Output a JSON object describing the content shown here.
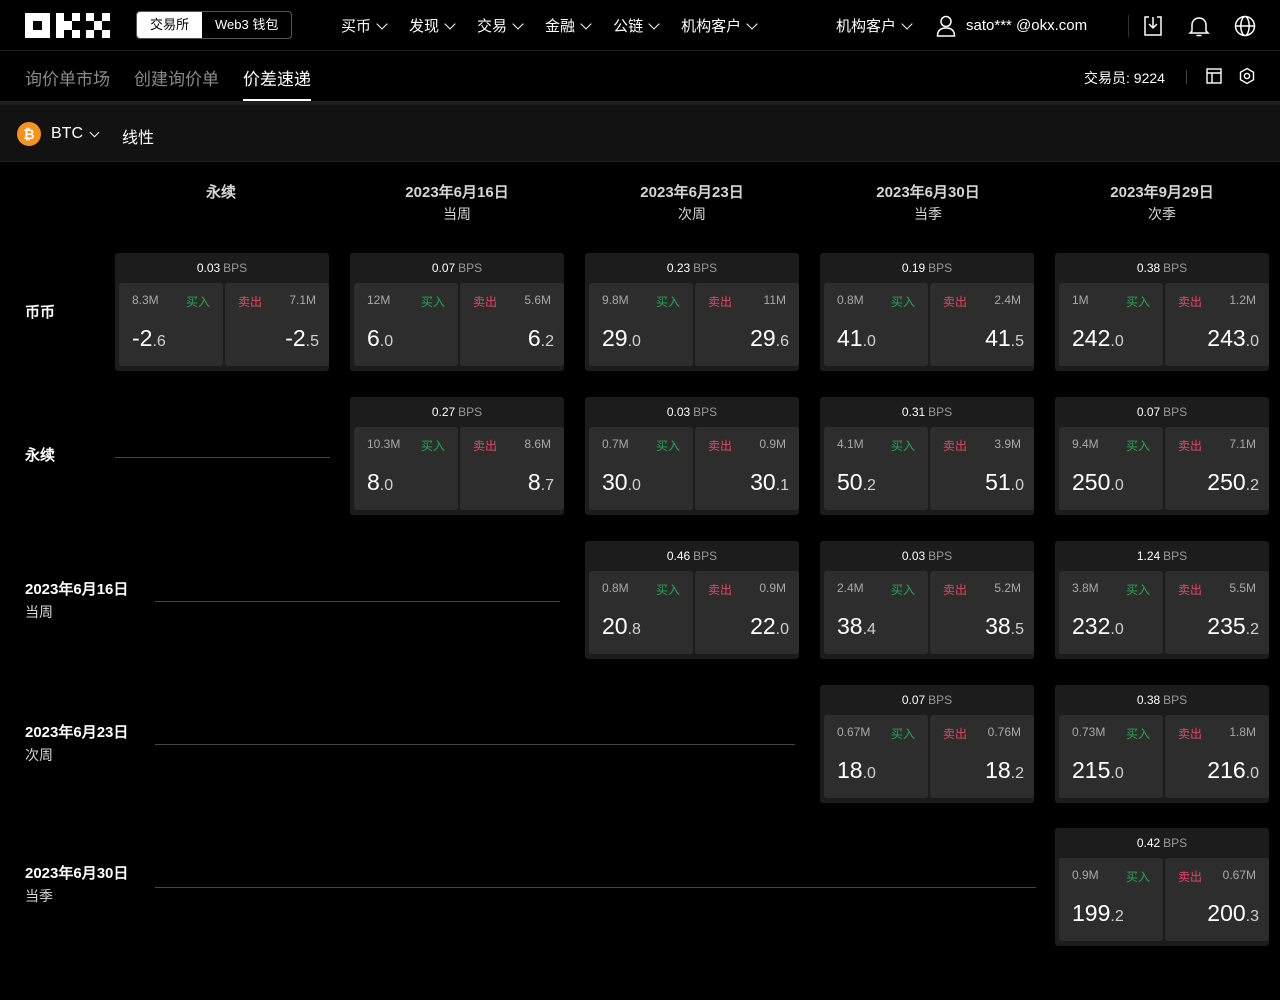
{
  "nav": {
    "switch": [
      "交易所",
      "Web3 钱包"
    ],
    "menu": [
      "买币",
      "发现",
      "交易",
      "金融",
      "公链",
      "机构客户"
    ],
    "institutional": "机构客户",
    "user": "sato*** @okx.com"
  },
  "subtabs": {
    "tabs": [
      "询价单市场",
      "创建询价单",
      "价差速递"
    ],
    "trader": "交易员: 9224"
  },
  "filter": {
    "coin": "BTC",
    "mode": "线性"
  },
  "columns": [
    {
      "date": "永续",
      "sub": ""
    },
    {
      "date": "2023年6月16日",
      "sub": "当周"
    },
    {
      "date": "2023年6月23日",
      "sub": "次周"
    },
    {
      "date": "2023年6月30日",
      "sub": "当季"
    },
    {
      "date": "2023年9月29日",
      "sub": "次季"
    }
  ],
  "rows": [
    {
      "date": "币币",
      "sub": ""
    },
    {
      "date": "永续",
      "sub": ""
    },
    {
      "date": "2023年6月16日",
      "sub": "当周"
    },
    {
      "date": "2023年6月23日",
      "sub": "次周"
    },
    {
      "date": "2023年6月30日",
      "sub": "当季"
    }
  ],
  "labels": {
    "buy": "买入",
    "sell": "卖出",
    "bps_unit": "BPS"
  },
  "cards": [
    {
      "row": 0,
      "col": 0,
      "bps": "0.03",
      "buy_vol": "8.3M",
      "buy_int": "-2",
      "buy_dec": ".6",
      "sell_vol": "7.1M",
      "sell_int": "-2",
      "sell_dec": ".5"
    },
    {
      "row": 0,
      "col": 1,
      "bps": "0.07",
      "buy_vol": "12M",
      "buy_int": "6",
      "buy_dec": ".0",
      "sell_vol": "5.6M",
      "sell_int": "6",
      "sell_dec": ".2"
    },
    {
      "row": 0,
      "col": 2,
      "bps": "0.23",
      "buy_vol": "9.8M",
      "buy_int": "29",
      "buy_dec": ".0",
      "sell_vol": "11M",
      "sell_int": "29",
      "sell_dec": ".6"
    },
    {
      "row": 0,
      "col": 3,
      "bps": "0.19",
      "buy_vol": "0.8M",
      "buy_int": "41",
      "buy_dec": ".0",
      "sell_vol": "2.4M",
      "sell_int": "41",
      "sell_dec": ".5"
    },
    {
      "row": 0,
      "col": 4,
      "bps": "0.38",
      "buy_vol": "1M",
      "buy_int": "242",
      "buy_dec": ".0",
      "sell_vol": "1.2M",
      "sell_int": "243",
      "sell_dec": ".0"
    },
    {
      "row": 1,
      "col": 1,
      "bps": "0.27",
      "buy_vol": "10.3M",
      "buy_int": "8",
      "buy_dec": ".0",
      "sell_vol": "8.6M",
      "sell_int": "8",
      "sell_dec": ".7"
    },
    {
      "row": 1,
      "col": 2,
      "bps": "0.03",
      "buy_vol": "0.7M",
      "buy_int": "30",
      "buy_dec": ".0",
      "sell_vol": "0.9M",
      "sell_int": "30",
      "sell_dec": ".1"
    },
    {
      "row": 1,
      "col": 3,
      "bps": "0.31",
      "buy_vol": "4.1M",
      "buy_int": "50",
      "buy_dec": ".2",
      "sell_vol": "3.9M",
      "sell_int": "51",
      "sell_dec": ".0"
    },
    {
      "row": 1,
      "col": 4,
      "bps": "0.07",
      "buy_vol": "9.4M",
      "buy_int": "250",
      "buy_dec": ".0",
      "sell_vol": "7.1M",
      "sell_int": "250",
      "sell_dec": ".2"
    },
    {
      "row": 2,
      "col": 2,
      "bps": "0.46",
      "buy_vol": "0.8M",
      "buy_int": "20",
      "buy_dec": ".8",
      "sell_vol": "0.9M",
      "sell_int": "22",
      "sell_dec": ".0"
    },
    {
      "row": 2,
      "col": 3,
      "bps": "0.03",
      "buy_vol": "2.4M",
      "buy_int": "38",
      "buy_dec": ".4",
      "sell_vol": "5.2M",
      "sell_int": "38",
      "sell_dec": ".5"
    },
    {
      "row": 2,
      "col": 4,
      "bps": "1.24",
      "buy_vol": "3.8M",
      "buy_int": "232",
      "buy_dec": ".0",
      "sell_vol": "5.5M",
      "sell_int": "235",
      "sell_dec": ".2"
    },
    {
      "row": 3,
      "col": 3,
      "bps": "0.07",
      "buy_vol": "0.67M",
      "buy_int": "18",
      "buy_dec": ".0",
      "sell_vol": "0.76M",
      "sell_int": "18",
      "sell_dec": ".2"
    },
    {
      "row": 3,
      "col": 4,
      "bps": "0.38",
      "buy_vol": "0.73M",
      "buy_int": "215",
      "buy_dec": ".0",
      "sell_vol": "1.8M",
      "sell_int": "216",
      "sell_dec": ".0"
    },
    {
      "row": 4,
      "col": 4,
      "bps": "0.42",
      "buy_vol": "0.9M",
      "buy_int": "199",
      "buy_dec": ".2",
      "sell_vol": "0.67M",
      "sell_int": "200",
      "sell_dec": ".3"
    }
  ],
  "colors": {
    "buy": "#25a750",
    "sell": "#e54566",
    "bitcoin": "#f7931a"
  },
  "icons": [
    "okx-logo-icon",
    "user-icon",
    "download-icon",
    "bell-icon",
    "globe-icon",
    "layout-icon",
    "settings-icon",
    "bitcoin-icon"
  ]
}
